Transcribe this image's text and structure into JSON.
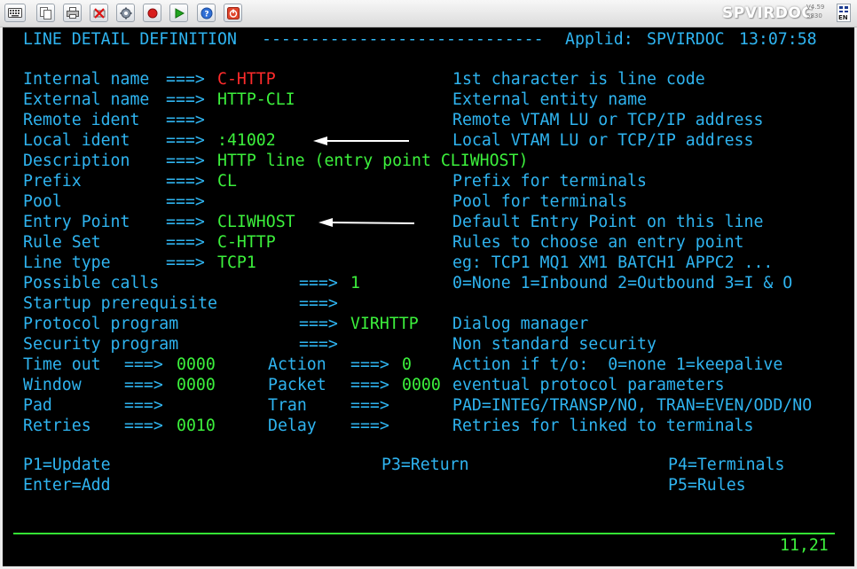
{
  "toolbar": {
    "buttons": [
      {
        "name": "keyboard-icon"
      },
      {
        "name": "copy-icon"
      },
      {
        "name": "print-icon"
      },
      {
        "name": "disconnect-icon"
      },
      {
        "name": "settings-icon"
      },
      {
        "name": "record-icon"
      },
      {
        "name": "play-icon"
      },
      {
        "name": "help-icon"
      },
      {
        "name": "power-icon"
      }
    ],
    "brand": "SPVIRDOC",
    "version_line1": "V4.59",
    "version_line2": "5830",
    "language": "EN"
  },
  "screen": {
    "title": "LINE DETAIL DEFINITION",
    "title_dashes": "-----------------------------",
    "applid_label": "Applid:",
    "applid": "SPVIRDOC",
    "time": "13:07:58",
    "arrow": "===>",
    "fields": [
      {
        "label": "Internal name",
        "value": "C-HTTP",
        "help": "1st character is line code"
      },
      {
        "label": "External name",
        "value": "HTTP-CLI",
        "help": "External entity name"
      },
      {
        "label": "Remote ident",
        "value": "",
        "help": "Remote VTAM LU or TCP/IP address"
      },
      {
        "label": "Local ident",
        "value": ":41002",
        "help": "Local VTAM LU or TCP/IP address"
      },
      {
        "label": "Description",
        "value": "HTTP line (entry point CLIWHOST)",
        "help": ""
      },
      {
        "label": "Prefix",
        "value": "CL",
        "help": "Prefix for terminals"
      },
      {
        "label": "Pool",
        "value": "",
        "help": "Pool for terminals"
      },
      {
        "label": "Entry Point",
        "value": "CLIWHOST",
        "help": "Default Entry Point on this line"
      },
      {
        "label": "Rule Set",
        "value": "C-HTTP",
        "help": "Rules to choose an entry point"
      },
      {
        "label": "Line type",
        "value": "TCP1",
        "help": "eg: TCP1 MQ1 XM1 BATCH1 APPC2 ..."
      },
      {
        "label": "Possible calls",
        "value": "1",
        "help": "0=None 1=Inbound 2=Outbound 3=I & O"
      },
      {
        "label": "Startup prerequisite",
        "value": "",
        "help": ""
      },
      {
        "label": "Protocol program",
        "value": "VIRHTTP",
        "help": "Dialog manager"
      },
      {
        "label": "Security program",
        "value": "",
        "help": "Non standard security"
      }
    ],
    "pairs": [
      {
        "label1": "Time out",
        "value1": "0000",
        "label2": "Action",
        "value2": "0",
        "help": "Action if t/o:  0=none 1=keepalive"
      },
      {
        "label1": "Window",
        "value1": "0000",
        "label2": "Packet",
        "value2": "0000",
        "help": "eventual protocol parameters"
      },
      {
        "label1": "Pad",
        "value1": "",
        "label2": "Tran",
        "value2": "",
        "help": "PAD=INTEG/TRANSP/NO, TRAN=EVEN/ODD/NO"
      },
      {
        "label1": "Retries",
        "value1": "0010",
        "label2": "Delay",
        "value2": "",
        "help": "Retries for linked to terminals"
      }
    ],
    "pfkeys": {
      "p1": "P1=Update",
      "enter": "Enter=Add",
      "p3": "P3=Return",
      "p4": "P4=Terminals",
      "p5": "P5=Rules"
    },
    "cursor_position": "11,21"
  }
}
